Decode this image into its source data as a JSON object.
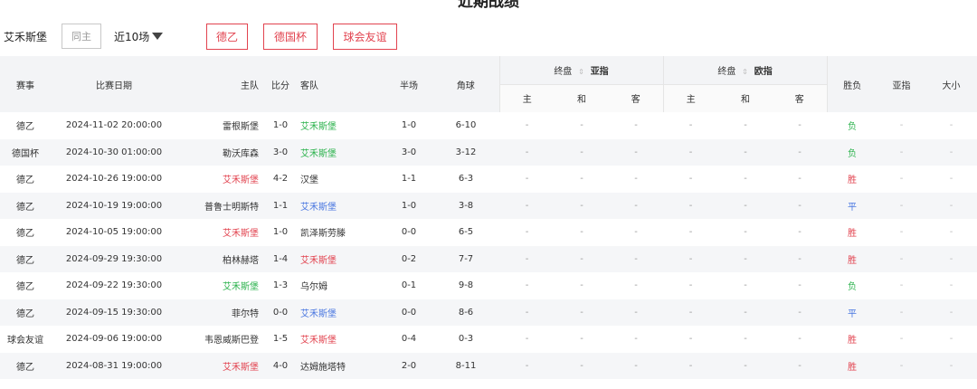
{
  "page_title": "近期战绩",
  "filter": {
    "team": "艾禾斯堡",
    "home_only": "同主",
    "recent": "近10场",
    "tags": [
      "德乙",
      "德国杯",
      "球会友谊"
    ]
  },
  "headers": {
    "league": "赛事",
    "date": "比赛日期",
    "home": "主队",
    "score": "比分",
    "away": "客队",
    "half": "半场",
    "corners": "角球",
    "group1_prefix": "终盘",
    "group1_name": "亚指",
    "group2_prefix": "终盘",
    "group2_name": "欧指",
    "sub_home": "主",
    "sub_draw": "和",
    "sub_away": "客",
    "result": "胜负",
    "asian": "亚指",
    "ou": "大小"
  },
  "colors": {
    "green": "#2bb24c",
    "red": "#e2434f",
    "blue": "#4a77e0"
  },
  "rows": [
    {
      "league": "德乙",
      "date": "2024-11-02 20:00:00",
      "home": "雷根斯堡",
      "home_color": "",
      "score": "1-0",
      "away": "艾禾斯堡",
      "away_color": "green",
      "half": "1-0",
      "corners": "6-10",
      "result": "负",
      "result_color": "green"
    },
    {
      "league": "德国杯",
      "date": "2024-10-30 01:00:00",
      "home": "勒沃库森",
      "home_color": "",
      "score": "3-0",
      "away": "艾禾斯堡",
      "away_color": "green",
      "half": "3-0",
      "corners": "3-12",
      "result": "负",
      "result_color": "green"
    },
    {
      "league": "德乙",
      "date": "2024-10-26 19:00:00",
      "home": "艾禾斯堡",
      "home_color": "red",
      "score": "4-2",
      "away": "汉堡",
      "away_color": "",
      "half": "1-1",
      "corners": "6-3",
      "result": "胜",
      "result_color": "red"
    },
    {
      "league": "德乙",
      "date": "2024-10-19 19:00:00",
      "home": "普鲁士明斯特",
      "home_color": "",
      "score": "1-1",
      "away": "艾禾斯堡",
      "away_color": "blue",
      "half": "1-0",
      "corners": "3-8",
      "result": "平",
      "result_color": "blue"
    },
    {
      "league": "德乙",
      "date": "2024-10-05 19:00:00",
      "home": "艾禾斯堡",
      "home_color": "red",
      "score": "1-0",
      "away": "凯泽斯劳滕",
      "away_color": "",
      "half": "0-0",
      "corners": "6-5",
      "result": "胜",
      "result_color": "red"
    },
    {
      "league": "德乙",
      "date": "2024-09-29 19:30:00",
      "home": "柏林赫塔",
      "home_color": "",
      "score": "1-4",
      "away": "艾禾斯堡",
      "away_color": "red",
      "half": "0-2",
      "corners": "7-7",
      "result": "胜",
      "result_color": "red"
    },
    {
      "league": "德乙",
      "date": "2024-09-22 19:30:00",
      "home": "艾禾斯堡",
      "home_color": "green",
      "score": "1-3",
      "away": "乌尔姆",
      "away_color": "",
      "half": "0-1",
      "corners": "9-8",
      "result": "负",
      "result_color": "green"
    },
    {
      "league": "德乙",
      "date": "2024-09-15 19:30:00",
      "home": "菲尔特",
      "home_color": "",
      "score": "0-0",
      "away": "艾禾斯堡",
      "away_color": "blue",
      "half": "0-0",
      "corners": "8-6",
      "result": "平",
      "result_color": "blue"
    },
    {
      "league": "球会友谊",
      "date": "2024-09-06 19:00:00",
      "home": "韦恩威斯巴登",
      "home_color": "",
      "score": "1-5",
      "away": "艾禾斯堡",
      "away_color": "red",
      "half": "0-4",
      "corners": "0-3",
      "result": "胜",
      "result_color": "red"
    },
    {
      "league": "德乙",
      "date": "2024-08-31 19:00:00",
      "home": "艾禾斯堡",
      "home_color": "red",
      "score": "4-0",
      "away": "达姆施塔特",
      "away_color": "",
      "half": "2-0",
      "corners": "8-11",
      "result": "胜",
      "result_color": "red"
    }
  ],
  "dash": "-",
  "sort_icon": "sort-icon"
}
